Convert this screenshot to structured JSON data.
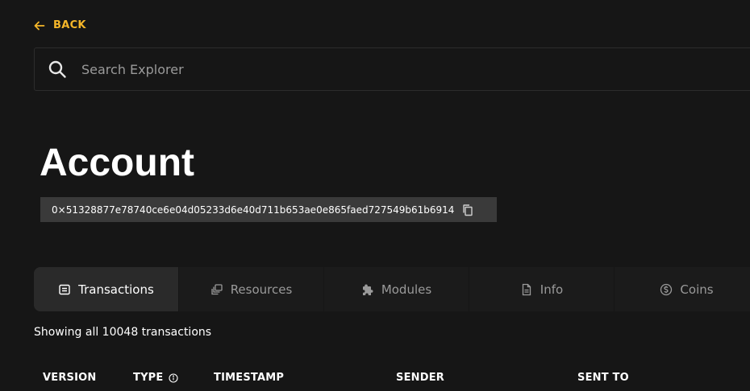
{
  "back": {
    "label": "BACK",
    "icon": "arrow-left-icon"
  },
  "search": {
    "placeholder": "Search Explorer",
    "value": "",
    "icon": "search-icon"
  },
  "page": {
    "title": "Account"
  },
  "account": {
    "address": "0×51328877e78740ce6e04d05233d6e40d711b653ae0e865faed727549b61b6914",
    "copy_icon": "copy-icon"
  },
  "tabs": [
    {
      "label": "Transactions",
      "icon": "transactions-icon",
      "active": true
    },
    {
      "label": "Resources",
      "icon": "resources-icon",
      "active": false
    },
    {
      "label": "Modules",
      "icon": "puzzle-icon",
      "active": false
    },
    {
      "label": "Info",
      "icon": "document-icon",
      "active": false
    },
    {
      "label": "Coins",
      "icon": "coin-icon",
      "active": false
    }
  ],
  "summary": {
    "text": "Showing all 10048 transactions"
  },
  "table": {
    "columns": [
      {
        "label": "VERSION"
      },
      {
        "label": "TYPE",
        "icon": "info-icon"
      },
      {
        "label": "TIMESTAMP"
      },
      {
        "label": "SENDER"
      },
      {
        "label": "SENT TO"
      }
    ]
  },
  "colors": {
    "accent": "#f5b629",
    "background": "#161616",
    "active_tab": "#2a2a2a",
    "chip": "#3a3a3a"
  }
}
